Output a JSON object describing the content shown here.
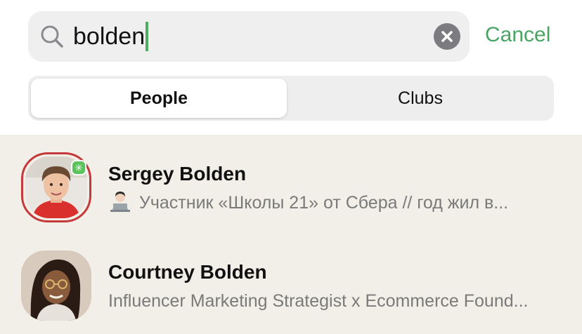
{
  "search": {
    "query": "bolden",
    "cancel_label": "Cancel"
  },
  "tabs": [
    {
      "label": "People",
      "active": true
    },
    {
      "label": "Clubs",
      "active": false
    }
  ],
  "results": [
    {
      "name": "Sergey Bolden",
      "bio": "Участник «Школы 21» от Сбера // год жил в...",
      "bio_emoji": "technologist-emoji",
      "online_badge": true,
      "ring_color": "#c43a3a"
    },
    {
      "name": "Courtney Bolden",
      "bio": "Influencer Marketing Strategist x Ecommerce Found...",
      "online_badge": false
    }
  ],
  "colors": {
    "accent_green": "#4aa564",
    "results_background": "#f1efe7",
    "search_background": "#efeff0"
  }
}
